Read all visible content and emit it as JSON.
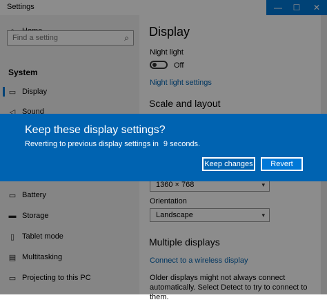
{
  "window": {
    "title": "Settings",
    "controls": {
      "minimize": "—",
      "maximize": "☐",
      "close": "✕"
    }
  },
  "sidebar": {
    "home": "Home",
    "search_placeholder": "Find a setting",
    "section": "System",
    "items": [
      {
        "label": "Display",
        "icon": "monitor-icon"
      },
      {
        "label": "Sound",
        "icon": "speaker-icon"
      },
      {
        "label": "Battery",
        "icon": "battery-icon"
      },
      {
        "label": "Storage",
        "icon": "storage-icon"
      },
      {
        "label": "Tablet mode",
        "icon": "tablet-icon"
      },
      {
        "label": "Multitasking",
        "icon": "multitasking-icon"
      },
      {
        "label": "Projecting to this PC",
        "icon": "projecting-icon"
      }
    ]
  },
  "main": {
    "title": "Display",
    "night_light_label": "Night light",
    "night_light_state": "Off",
    "night_light_settings": "Night light settings",
    "scale_heading": "Scale and layout",
    "resolution_value": "1360 × 768",
    "orientation_label": "Orientation",
    "orientation_value": "Landscape",
    "multi_heading": "Multiple displays",
    "wireless_link": "Connect to a wireless display",
    "detect_desc": "Older displays might not always connect automatically. Select Detect to try to connect to them."
  },
  "dialog": {
    "title": "Keep these display settings?",
    "message_prefix": "Reverting to previous display settings in",
    "seconds": "9",
    "message_suffix": "seconds.",
    "keep_label": "Keep changes",
    "revert_label": "Revert"
  },
  "colors": {
    "accent": "#0078d7",
    "dialog": "#0063b1"
  }
}
